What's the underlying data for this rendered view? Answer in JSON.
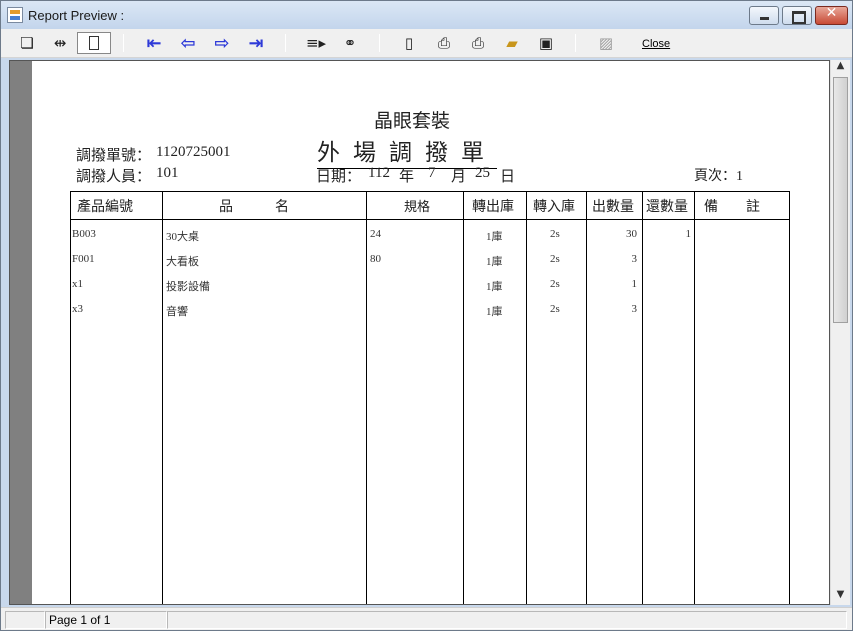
{
  "window": {
    "title": "Report Preview :"
  },
  "toolbar": {
    "close_label": "Close"
  },
  "status": {
    "page_text": "Page 1 of 1"
  },
  "report": {
    "company": "晶眼套裝",
    "title": "外場調撥單",
    "transfer_no_label": "調撥單號：",
    "transfer_no": "1120725001",
    "staff_label": "調撥人員：",
    "staff": "101",
    "date_label": "日期：",
    "date_year": "112",
    "year_unit": "年",
    "date_month": "7",
    "month_unit": "月",
    "date_day": "25",
    "day_unit": "日",
    "page_label": "頁次：1",
    "headers": [
      "產品編號",
      "品　　　名",
      "規格",
      "轉出庫",
      "轉入庫",
      "出數量",
      "還數量",
      "備　　註"
    ],
    "rows": [
      {
        "code": "B003",
        "name": "30大桌",
        "spec": "24",
        "out": "1庫",
        "in": "2s",
        "qty_out": "30",
        "qty_ret": "1",
        "note": ""
      },
      {
        "code": "F001",
        "name": "大看板",
        "spec": "80",
        "out": "1庫",
        "in": "2s",
        "qty_out": "3",
        "qty_ret": "",
        "note": ""
      },
      {
        "code": "x1",
        "name": "投影設備",
        "spec": "",
        "out": "1庫",
        "in": "2s",
        "qty_out": "1",
        "qty_ret": "",
        "note": ""
      },
      {
        "code": "x3",
        "name": "音響",
        "spec": "",
        "out": "1庫",
        "in": "2s",
        "qty_out": "3",
        "qty_ret": "",
        "note": ""
      }
    ]
  }
}
